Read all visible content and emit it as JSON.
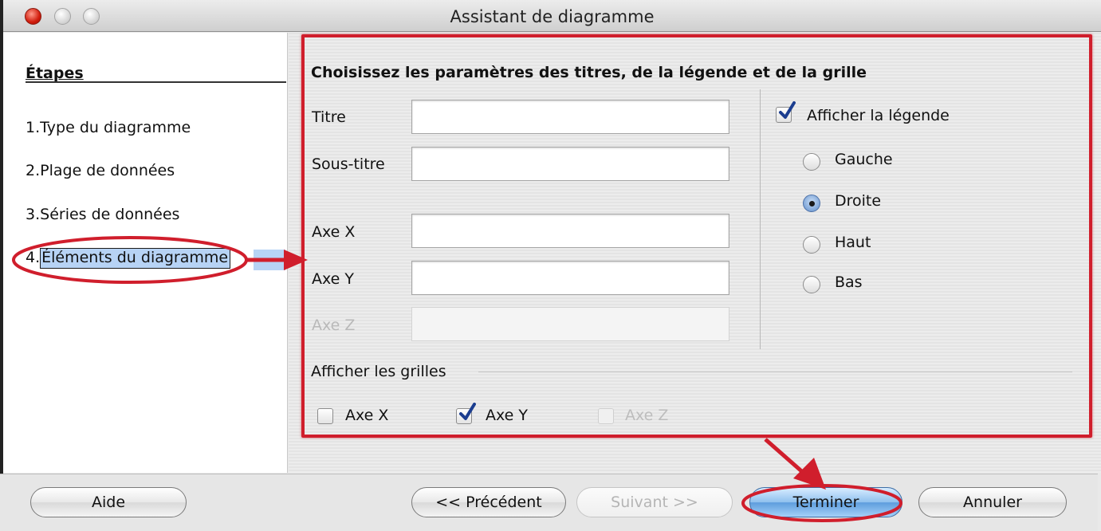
{
  "window": {
    "title": "Assistant de diagramme"
  },
  "sidebar": {
    "heading": "Étapes",
    "steps": [
      {
        "number": "1.",
        "label": "Type du diagramme"
      },
      {
        "number": "2.",
        "label": "Plage de données"
      },
      {
        "number": "3.",
        "label": "Séries de données"
      },
      {
        "number": "4.",
        "label": "Éléments du diagramme"
      }
    ]
  },
  "main": {
    "section_title": "Choisissez les paramètres des titres, de la légende et de la grille",
    "fields": {
      "titre": {
        "label": "Titre",
        "value": ""
      },
      "sous_titre": {
        "label": "Sous-titre",
        "value": ""
      },
      "axe_x": {
        "label": "Axe X",
        "value": ""
      },
      "axe_y": {
        "label": "Axe Y",
        "value": ""
      },
      "axe_z": {
        "label": "Axe Z",
        "value": ""
      }
    },
    "legend": {
      "show_label": "Afficher la légende",
      "show_checked": true,
      "options": [
        "Gauche",
        "Droite",
        "Haut",
        "Bas"
      ],
      "selected": "Droite"
    },
    "grids": {
      "label": "Afficher les grilles",
      "x": {
        "label": "Axe X",
        "checked": false
      },
      "y": {
        "label": "Axe Y",
        "checked": true
      },
      "z": {
        "label": "Axe Z",
        "checked": false,
        "disabled": true
      }
    }
  },
  "buttons": {
    "help": "Aide",
    "previous": "<< Précédent",
    "next": "Suivant >>",
    "finish": "Terminer",
    "cancel": "Annuler"
  },
  "colors": {
    "annotation": "#d01e2c",
    "selection": "#b7d3f5",
    "primary_button": "#6aa7e4"
  }
}
